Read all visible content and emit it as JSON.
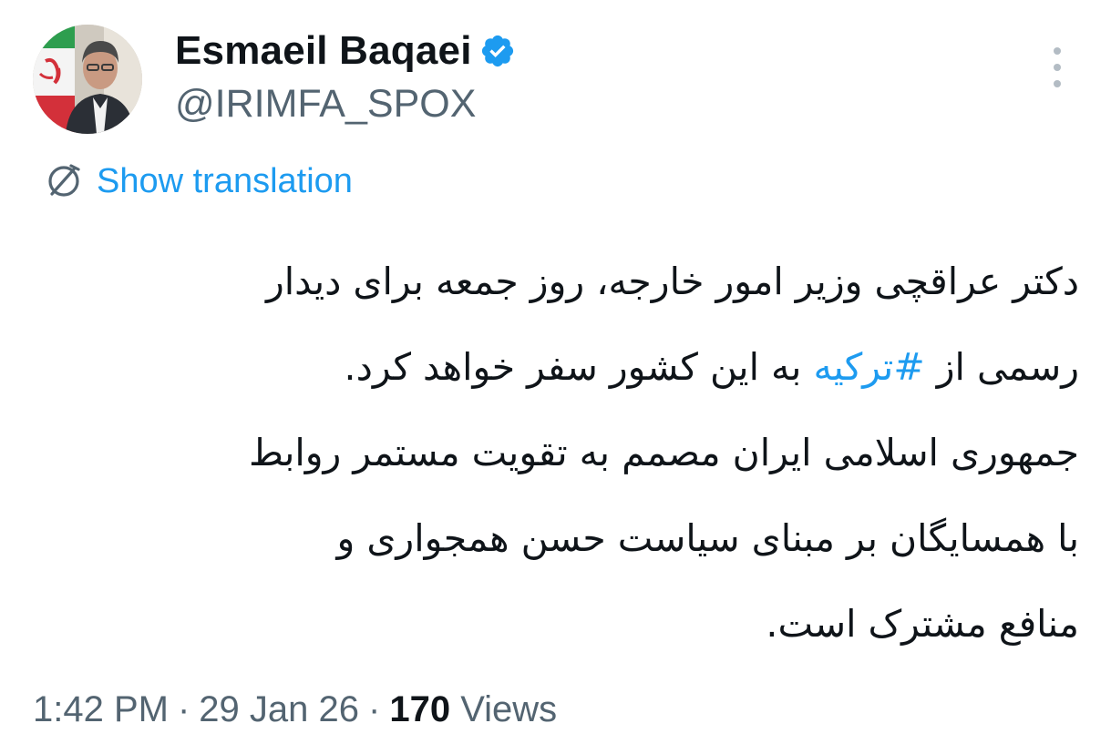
{
  "author": {
    "display_name": "Esmaeil Baqaei",
    "handle": "@IRIMFA_SPOX",
    "verified": true,
    "avatar_icon": "profile-photo"
  },
  "actions": {
    "more_icon": "more-vertical-icon",
    "show_translation": "Show translation"
  },
  "tweet": {
    "lines": [
      {
        "text": "دکتر عراقچی وزیر امور خارجه، روز جمعه برای دیدار"
      },
      {
        "before": "رسمی از ",
        "hashtag": "#ترکیه",
        "after": " به این کشور سفر خواهد کرد."
      },
      {
        "text": "جمهوری اسلامی ایران مصمم به تقویت مستمر روابط"
      },
      {
        "text": "با همسایگان بر مبنای سیاست حسن همجواری و"
      },
      {
        "text": "منافع مشترک است."
      }
    ]
  },
  "meta": {
    "time": "1:42 PM",
    "separator": "·",
    "date": "29 Jan 26",
    "views_count": "170",
    "views_label": "Views"
  },
  "colors": {
    "link": "#1d9bf0",
    "secondary_text": "#536471",
    "primary_text": "#0f1419",
    "verified_badge": "#1d9bf0"
  }
}
